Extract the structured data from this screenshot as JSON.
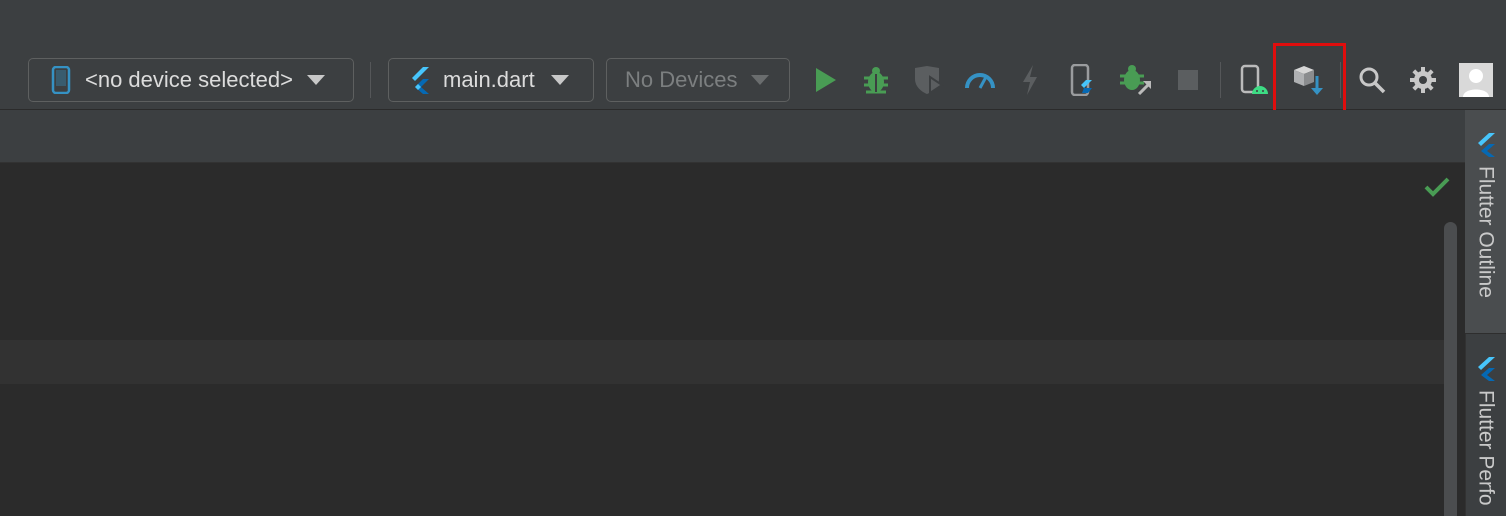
{
  "toolbar": {
    "device_selector": {
      "label": "<no device selected>",
      "icon": "phone-icon"
    },
    "run_config": {
      "label": "main.dart",
      "icon": "flutter-icon"
    },
    "devices_dropdown": {
      "label": "No Devices",
      "enabled": false
    },
    "actions": [
      {
        "name": "run",
        "icon": "play-icon",
        "color": "#499c54"
      },
      {
        "name": "debug",
        "icon": "bug-icon",
        "color": "#499c54"
      },
      {
        "name": "run-with-coverage",
        "icon": "shield-play-icon",
        "enabled": false
      },
      {
        "name": "profile",
        "icon": "speedometer-icon",
        "color": "#3592c4"
      },
      {
        "name": "hot-reload",
        "icon": "lightning-icon",
        "enabled": false
      },
      {
        "name": "hot-restart",
        "icon": "phone-flutter-icon"
      },
      {
        "name": "attach-debugger",
        "icon": "bug-arrow-icon",
        "color": "#499c54"
      },
      {
        "name": "stop",
        "icon": "stop-icon",
        "enabled": false
      },
      {
        "name": "device-manager",
        "icon": "android-device-icon"
      },
      {
        "name": "sdk-manager",
        "icon": "box-download-icon",
        "highlighted": true
      },
      {
        "name": "search",
        "icon": "search-icon"
      },
      {
        "name": "settings",
        "icon": "gear-icon"
      },
      {
        "name": "account",
        "icon": "avatar-icon"
      }
    ]
  },
  "right_panel": {
    "tabs": [
      {
        "label": "Flutter Outline",
        "icon": "flutter-icon"
      },
      {
        "label": "Flutter Perfo",
        "icon": "flutter-icon"
      }
    ]
  },
  "editor": {
    "inspection_status_icon": "checkmark-icon",
    "status_color": "#499c54"
  },
  "colors": {
    "highlight": "#e00d0d",
    "accent_blue": "#3592c4",
    "green": "#499c54"
  }
}
